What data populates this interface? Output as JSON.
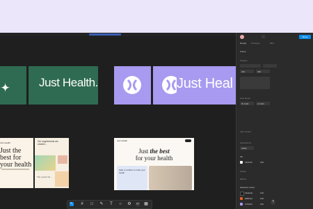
{
  "canvas": {
    "frames": {
      "green_logo_text": "Just Health.",
      "purple_logo_text": "Just Heal",
      "left_card_brand": "Just Health",
      "left_card_headline": "Just the best for your health",
      "mid_card_text": "Our supplements are created ...",
      "mid_card_small": "The expert tell ...",
      "web_nav_brand": "Just Health",
      "web_headline_pre": "Just ",
      "web_headline_em": "the best",
      "web_headline_post": "for your health",
      "web_panel_text": "Start a nutrition to track your health"
    }
  },
  "props": {
    "share": "Share",
    "tabs": [
      "Design",
      "Prototype"
    ],
    "zoom": "66%",
    "frame_label": "Frame",
    "position_label": "Position",
    "constraints": {
      "x": "220",
      "y": "460"
    },
    "layout_label": "Auto layout",
    "w": "W 1440",
    "h": "H 1024",
    "clip": "Clip content",
    "appearance_label": "Appearance",
    "opacity": "100%",
    "fill_label": "Fill",
    "fill_value": "FFFFFF",
    "fill_opacity": "100",
    "stroke_label": "Stroke",
    "effects_label": "Effects",
    "selection_colors_label": "Selection colors",
    "colors": [
      {
        "hex": "#1E1E1E",
        "label": "1E1E1E",
        "pct": "100"
      },
      {
        "hex": "#E85D1C",
        "label": "E85D1C",
        "pct": "100"
      },
      {
        "hex": "#A79AF0",
        "label": "A79AF0",
        "pct": "100"
      },
      {
        "hex": "#FFFFFF",
        "label": "FFFFFF",
        "pct": "100"
      }
    ]
  },
  "toolbar": {
    "tools": [
      "move-tool",
      "frame-tool",
      "shape-tool",
      "pen-tool",
      "text-tool",
      "comment-tool",
      "actions-tool",
      "dev-mode-toggle",
      "ui3-toggle"
    ]
  },
  "help": "?"
}
